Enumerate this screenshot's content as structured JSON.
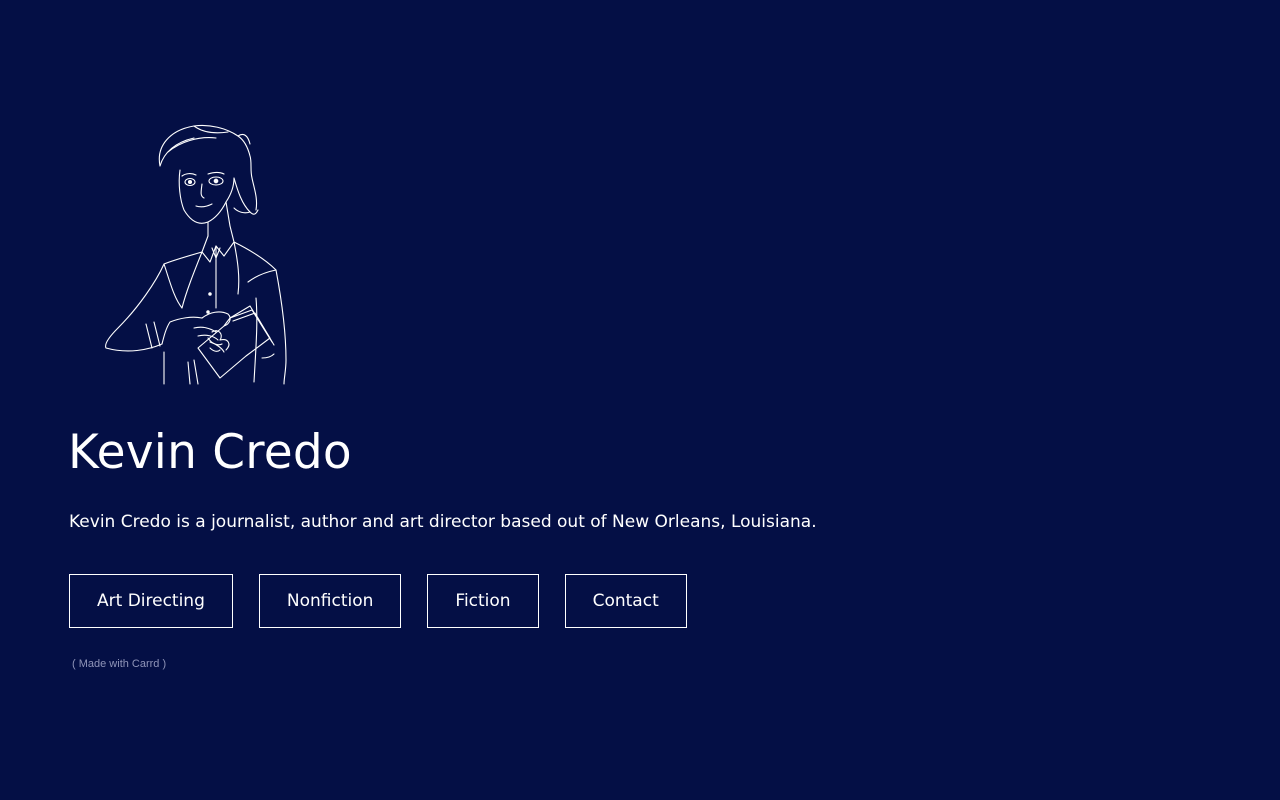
{
  "profile": {
    "name": "Kevin Credo",
    "bio": "Kevin Credo is a journalist, author and art director based out of New Orleans, Louisiana."
  },
  "nav": {
    "buttons": [
      {
        "label": "Art Directing"
      },
      {
        "label": "Nonfiction"
      },
      {
        "label": "Fiction"
      },
      {
        "label": "Contact"
      }
    ]
  },
  "footer": {
    "open_paren": "(",
    "link": "Made with Carrd",
    "close_paren": ")"
  },
  "colors": {
    "background": "#040f45",
    "foreground": "#ffffff",
    "muted": "#8f94b8"
  },
  "icons": {
    "portrait": "line-drawing-man-with-book"
  }
}
